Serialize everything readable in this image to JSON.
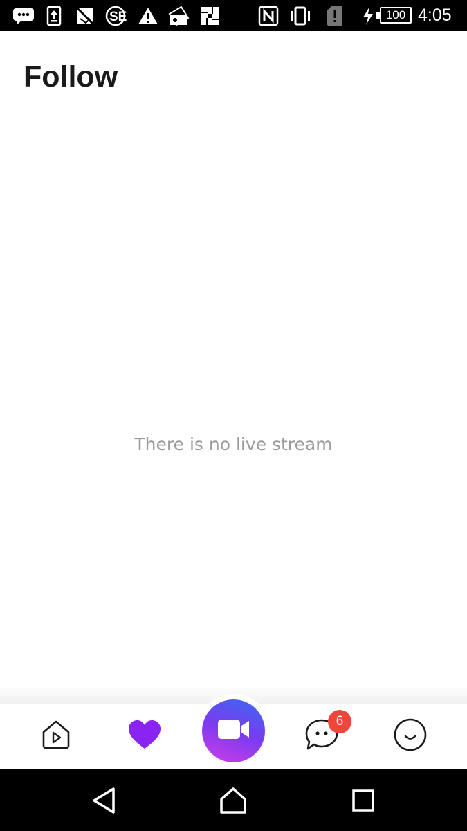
{
  "status_bar": {
    "icons": [
      "messaging-icon",
      "upload-icon",
      "no-sim-card-icon",
      "se-app-icon",
      "warning-icon",
      "photo-stack-icon",
      "picture-icon",
      "nfc-icon",
      "vibrate-icon",
      "sim-alert-icon",
      "charging-icon"
    ],
    "battery": "100",
    "time": "4:05"
  },
  "page": {
    "title": "Follow",
    "empty_message": "There is no live stream"
  },
  "tab_bar": {
    "tabs": [
      "live-tab",
      "follow-tab",
      "go-live-button",
      "messages-tab",
      "profile-tab"
    ],
    "active_tab": "follow-tab",
    "messages_badge": "6",
    "active_color": "#8a24f0",
    "badge_color": "#f0453a"
  },
  "nav_bar": {
    "buttons": [
      "back-icon",
      "home-icon",
      "recents-icon"
    ]
  }
}
